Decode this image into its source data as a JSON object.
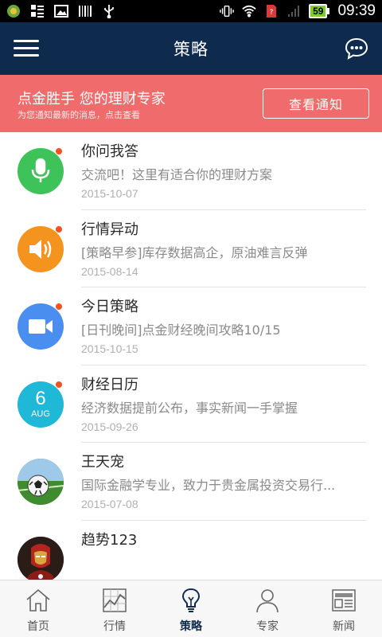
{
  "status": {
    "time": "09:39",
    "battery": "59"
  },
  "appbar": {
    "title": "策略"
  },
  "banner": {
    "title": "点金胜手 您的理财专家",
    "subtitle": "为您通知最新的消息，点击查看",
    "button_label": "查看通知"
  },
  "list": {
    "items": [
      {
        "title": "你问我答",
        "desc": "交流吧！这里有适合你的理财方案",
        "date": "2015-10-07",
        "icon": "microphone-icon",
        "color": "#3ec35a"
      },
      {
        "title": "行情异动",
        "desc": "[策略早参]库存数据高企，原油难言反弹",
        "date": "2015-08-14",
        "icon": "speaker-icon",
        "color": "#f4931e"
      },
      {
        "title": "今日策略",
        "desc": "[日刊晚间]点金财经晚间攻略10/15",
        "date": "2015-10-15",
        "icon": "video-camera-icon",
        "color": "#4a8ff0"
      },
      {
        "title": "财经日历",
        "desc": "经济数据提前公布，事实新闻一手掌握",
        "date": "2015-09-26",
        "icon": "calendar-icon",
        "color": "#1fb8d6",
        "cal_day": "6",
        "cal_month": "AUG"
      },
      {
        "title": "王天宠",
        "desc": "国际金融学专业，致力于贵金属投资交易行...",
        "date": "2015-07-08",
        "icon": "soccer-ball-avatar",
        "color": "#3a7d2c"
      },
      {
        "title": "趋势123",
        "desc": "",
        "date": "",
        "icon": "ironman-avatar",
        "color": "#1a1a1a"
      }
    ]
  },
  "tabs": [
    {
      "label": "首页",
      "icon": "home-icon"
    },
    {
      "label": "行情",
      "icon": "chart-icon"
    },
    {
      "label": "策略",
      "icon": "lightbulb-icon",
      "active": true
    },
    {
      "label": "专家",
      "icon": "person-icon"
    },
    {
      "label": "新闻",
      "icon": "newspaper-icon"
    }
  ]
}
